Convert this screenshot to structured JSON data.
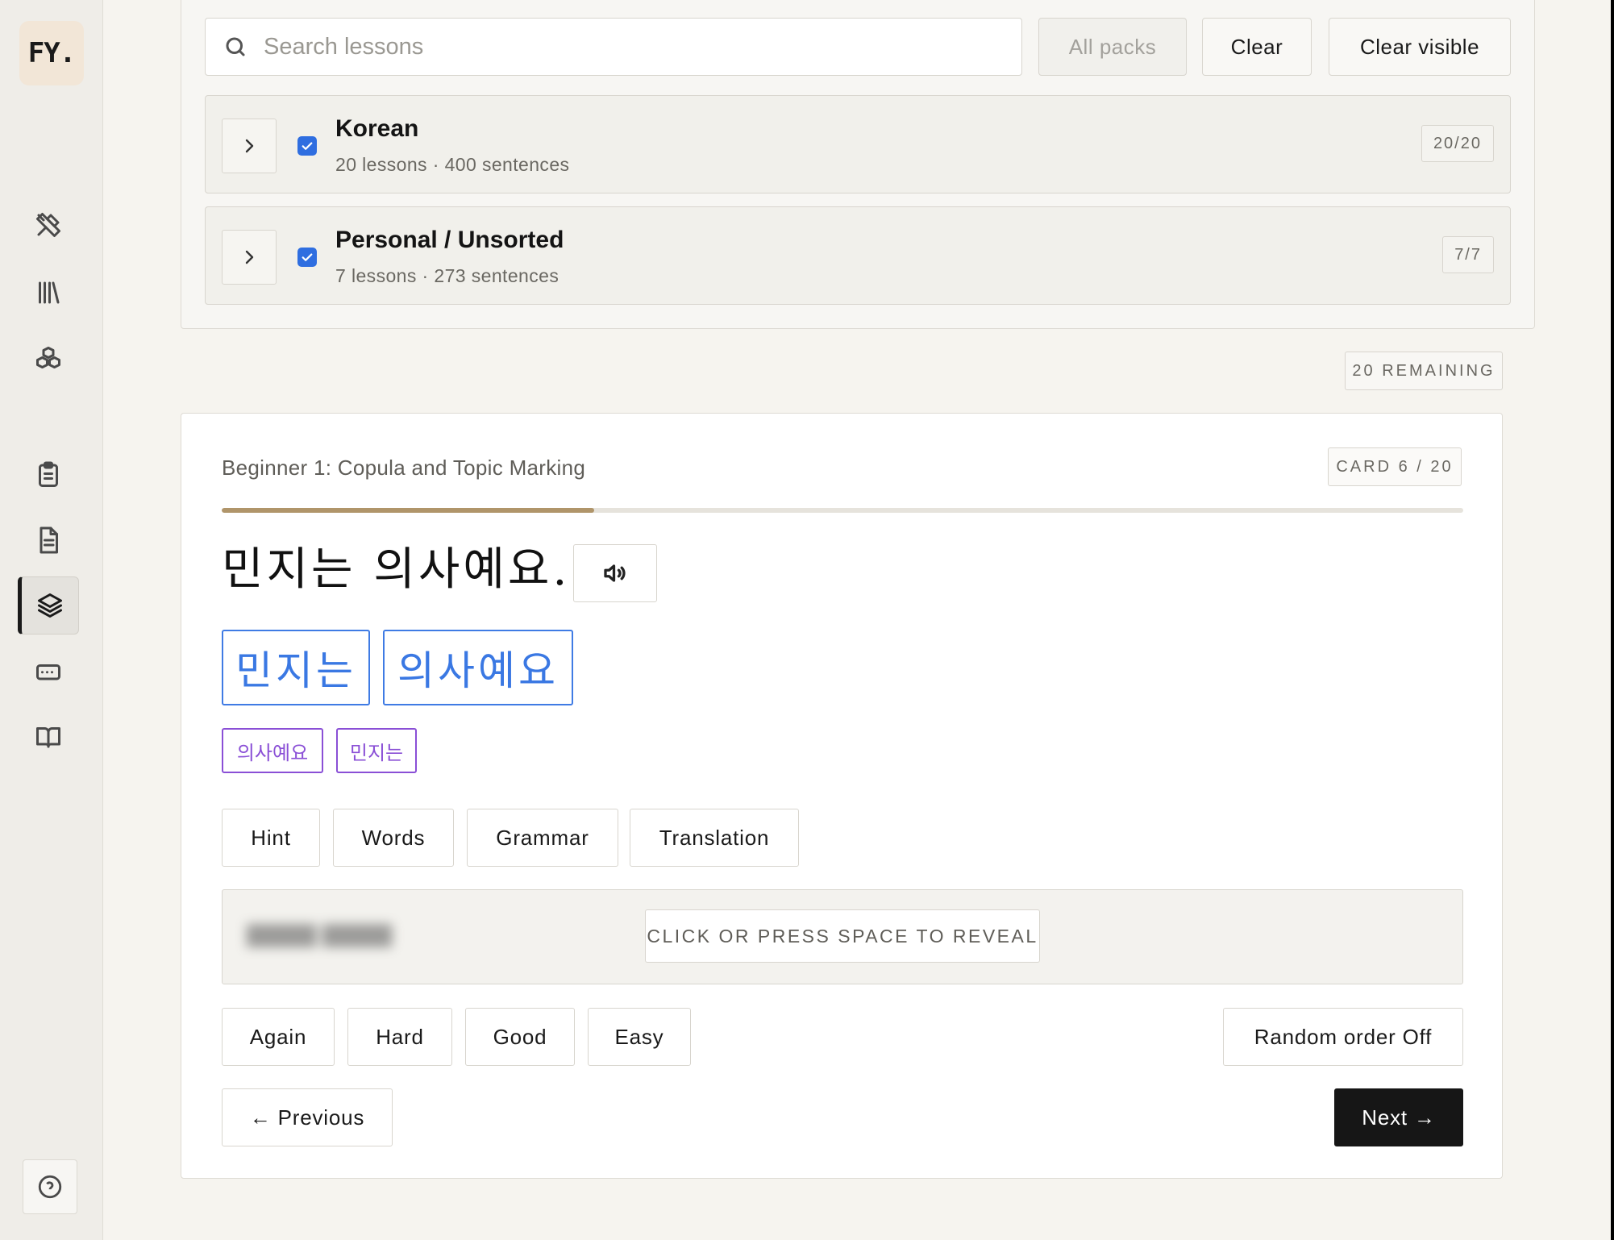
{
  "app": {
    "logo_text": "FY.",
    "nav_icons": [
      "tools-icon",
      "library-icon",
      "boxes-icon",
      "clipboard-icon",
      "document-icon",
      "layers-icon",
      "keyboard-icon",
      "book-open-icon"
    ],
    "active_nav": "layers-icon",
    "help_icon": "help-circle-icon"
  },
  "packs": {
    "search_placeholder": "Search lessons",
    "search_value": "",
    "buttons": {
      "all_packs": "All packs",
      "clear": "Clear",
      "clear_visible": "Clear visible"
    },
    "items": [
      {
        "title": "Korean",
        "subtitle": "20 lessons · 400 sentences",
        "count": "20/20",
        "checked": true
      },
      {
        "title": "Personal / Unsorted",
        "subtitle": "7 lessons · 273 sentences",
        "count": "7/7",
        "checked": true
      }
    ]
  },
  "remaining": "20 REMAINING",
  "card": {
    "lesson_title": "Beginner 1: Copula and Topic Marking",
    "counter": "CARD 6 / 20",
    "progress": 0.3,
    "sentence": "민지는 의사예요.",
    "tokens": [
      "민지는",
      "의사예요"
    ],
    "chips": [
      "의사예요",
      "민지는"
    ],
    "tools": {
      "hint": "Hint",
      "words": "Words",
      "grammar": "Grammar",
      "translation": "Translation"
    },
    "reveal_label": "CLICK OR PRESS SPACE TO REVEAL",
    "grades": {
      "again": "Again",
      "hard": "Hard",
      "good": "Good",
      "easy": "Easy"
    },
    "random_order": "Random order Off",
    "previous": "← Previous",
    "next": "Next →"
  },
  "colors": {
    "accent_blue": "#3f7be4",
    "chip_purple": "#8a4fd6",
    "progress": "#b0956a",
    "primary_button": "#161616"
  }
}
